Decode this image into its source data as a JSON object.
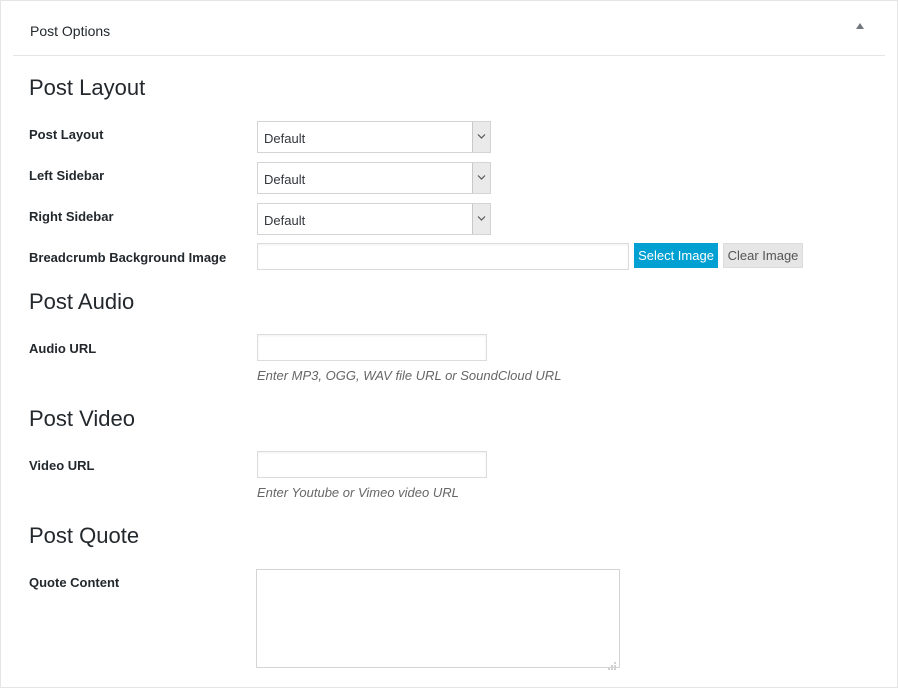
{
  "panel": {
    "title": "Post Options",
    "toggle_icon": "triangle-up-icon"
  },
  "post_layout_section": {
    "heading": "Post Layout",
    "fields": {
      "post_layout": {
        "label": "Post Layout",
        "value": "Default"
      },
      "left_sidebar": {
        "label": "Left Sidebar",
        "value": "Default"
      },
      "right_sidebar": {
        "label": "Right Sidebar",
        "value": "Default"
      },
      "breadcrumb_bg": {
        "label": "Breadcrumb Background Image",
        "value": "",
        "select_button": "Select Image",
        "clear_button": "Clear Image"
      }
    }
  },
  "post_audio_section": {
    "heading": "Post Audio",
    "audio_url": {
      "label": "Audio URL",
      "value": "",
      "hint": "Enter MP3, OGG, WAV file URL or SoundCloud URL"
    }
  },
  "post_video_section": {
    "heading": "Post Video",
    "video_url": {
      "label": "Video URL",
      "value": "",
      "hint": "Enter Youtube or Vimeo video URL"
    }
  },
  "post_quote_section": {
    "heading": "Post Quote",
    "quote_content": {
      "label": "Quote Content",
      "value": ""
    }
  },
  "colors": {
    "primary_button": "#00a0d2",
    "secondary_button": "#e6e6e6",
    "border": "#e5e5e5"
  }
}
